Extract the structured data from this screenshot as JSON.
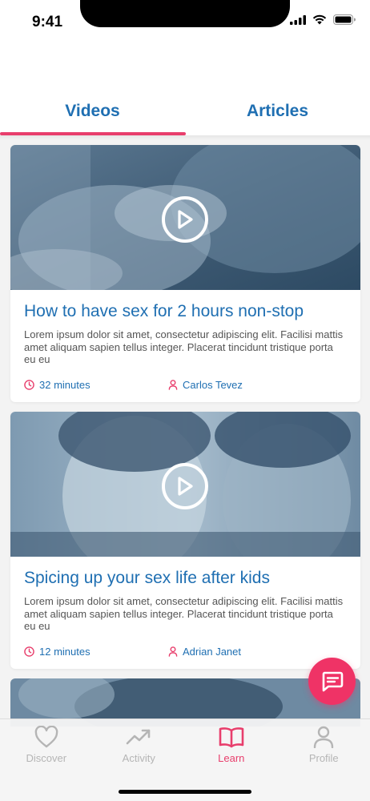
{
  "status": {
    "time": "9:41"
  },
  "tabs": {
    "videos": "Videos",
    "articles": "Articles"
  },
  "cards": [
    {
      "title": "How to have sex for 2 hours non-stop",
      "description": "Lorem ipsum dolor sit amet, consectetur adipiscing elit. Facilisi mattis amet aliquam sapien tellus integer. Placerat tincidunt tristique porta eu eu",
      "duration": "32 minutes",
      "author": "Carlos Tevez"
    },
    {
      "title": "Spicing up your sex life after kids",
      "description": "Lorem ipsum dolor sit amet, consectetur adipiscing elit. Facilisi mattis amet aliquam sapien tellus integer. Placerat tincidunt tristique porta eu eu",
      "duration": "12 minutes",
      "author": "Adrian Janet"
    }
  ],
  "tabbar": {
    "items": [
      {
        "label": "Discover",
        "icon": "heart-icon"
      },
      {
        "label": "Activity",
        "icon": "trending-up-icon"
      },
      {
        "label": "Learn",
        "icon": "book-open-icon"
      },
      {
        "label": "Profile",
        "icon": "person-icon"
      }
    ]
  },
  "colors": {
    "accent": "#e83e6c",
    "primary": "#1f6fb2",
    "fab": "#ef3366"
  }
}
